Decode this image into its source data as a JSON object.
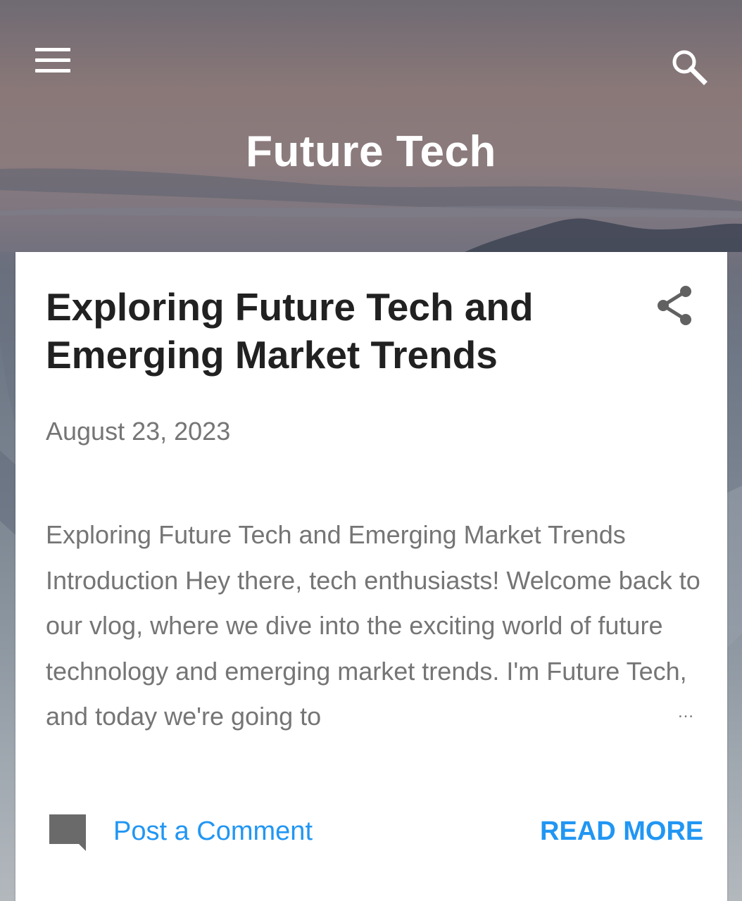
{
  "header": {
    "site_title": "Future Tech",
    "menu_icon": "hamburger-menu-icon",
    "search_icon": "search-icon"
  },
  "post": {
    "title": "Exploring Future Tech and Emerging Market Trends",
    "date": "August 23, 2023",
    "snippet": "Exploring Future Tech and Emerging Market Trends Introduction Hey there, tech enthusiasts! Welcome back to our vlog, where we dive into the exciting world of future technology and emerging market trends. I'm Future Tech, and today we're going to",
    "ellipsis": "…",
    "share_icon": "share-icon",
    "comment_icon": "comment-icon",
    "comment_label": "Post a Comment",
    "read_more_label": "READ MORE"
  },
  "colors": {
    "accent": "#2196f3",
    "title_text": "#212121",
    "secondary_text": "#757575"
  }
}
